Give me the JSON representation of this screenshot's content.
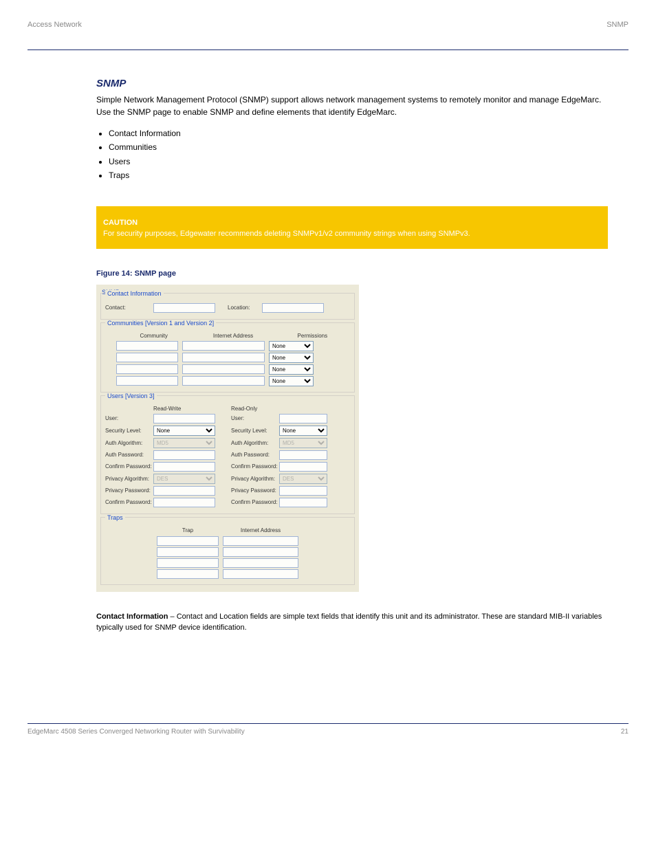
{
  "header": {
    "title": "Access Network",
    "section": "SNMP"
  },
  "snmp": {
    "heading": "SNMP",
    "intro": "Simple Network Management Protocol (SNMP) support allows network management systems to remotely monitor and manage EdgeMarc. Use the SNMP page to enable SNMP and define elements that identify EdgeMarc.",
    "bullets": [
      "Contact Information",
      "Communities",
      "Users",
      "Traps"
    ],
    "caution": {
      "label": "CAUTION",
      "text": "For security purposes, Edgewater recommends deleting SNMPv1/v2 community strings when using SNMPv3."
    },
    "figure_label": "Figure 14: SNMP page",
    "figure_caption_strong": "Contact Information",
    "figure_caption_rest": " – Contact and Location fields are simple text fields that identify this unit and its administrator. These are standard MIB-II variables typically used for SNMP device identification."
  },
  "form": {
    "title": "SNMP",
    "contact": {
      "legend": "Contact Information",
      "contact_label": "Contact:",
      "location_label": "Location:"
    },
    "communities": {
      "legend": "Communities [Version 1 and Version 2]",
      "col_community": "Community",
      "col_addr": "Internet Address",
      "col_perm": "Permissions",
      "perm_value": "None"
    },
    "users": {
      "legend": "Users [Version 3]",
      "rw": "Read-Write",
      "ro": "Read-Only",
      "user": "User:",
      "sec": "Security Level:",
      "sec_val": "None",
      "auth_alg": "Auth Algorithm:",
      "auth_alg_val": "MD5",
      "auth_pw": "Auth Password:",
      "confirm_pw": "Confirm Password:",
      "priv_alg": "Privacy Algorithm:",
      "priv_alg_val": "DES",
      "priv_pw": "Privacy Password:"
    },
    "traps": {
      "legend": "Traps",
      "col_trap": "Trap",
      "col_addr": "Internet Address"
    }
  },
  "footer": {
    "left": "EdgeMarc 4508 Series Converged Networking Router with Survivability",
    "right": "21"
  }
}
